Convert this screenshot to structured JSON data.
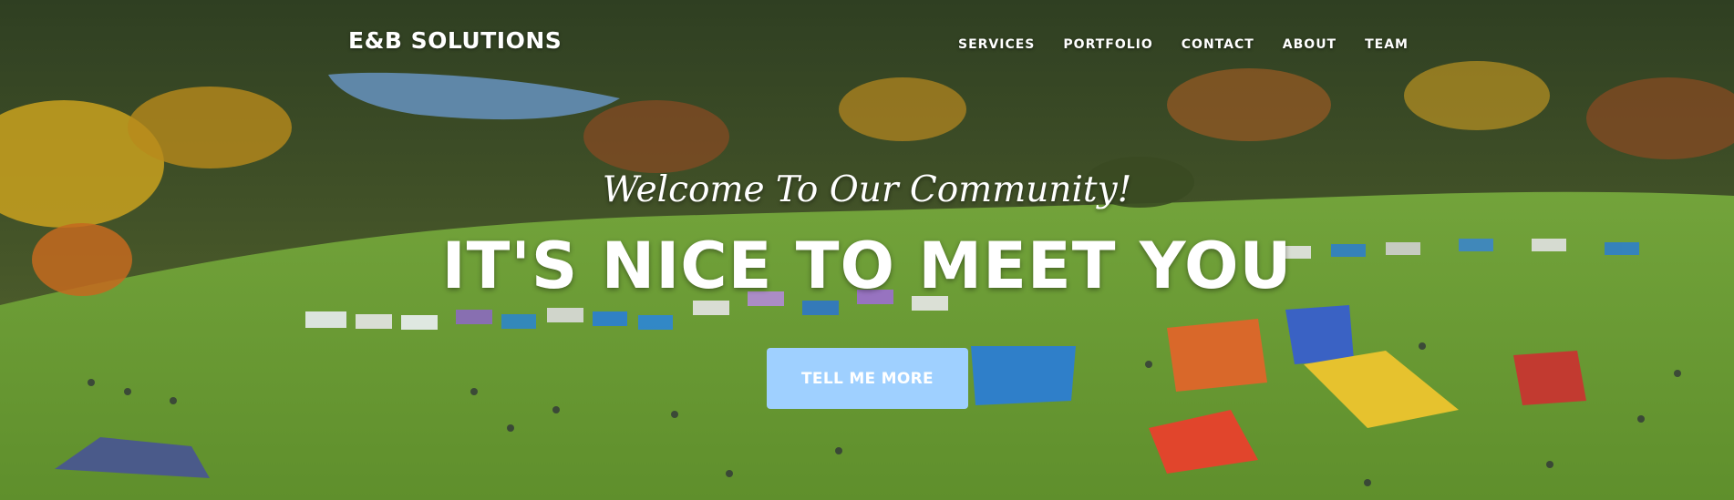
{
  "navbar": {
    "brand": "E&B SOLUTIONS",
    "links": [
      "SERVICES",
      "PORTFOLIO",
      "CONTACT",
      "ABOUT",
      "TEAM"
    ]
  },
  "hero": {
    "lead": "Welcome To Our Community!",
    "heading": "IT'S NICE TO MEET YOU",
    "cta_label": "TELL ME MORE",
    "cta_color": "#9fd0ff"
  }
}
